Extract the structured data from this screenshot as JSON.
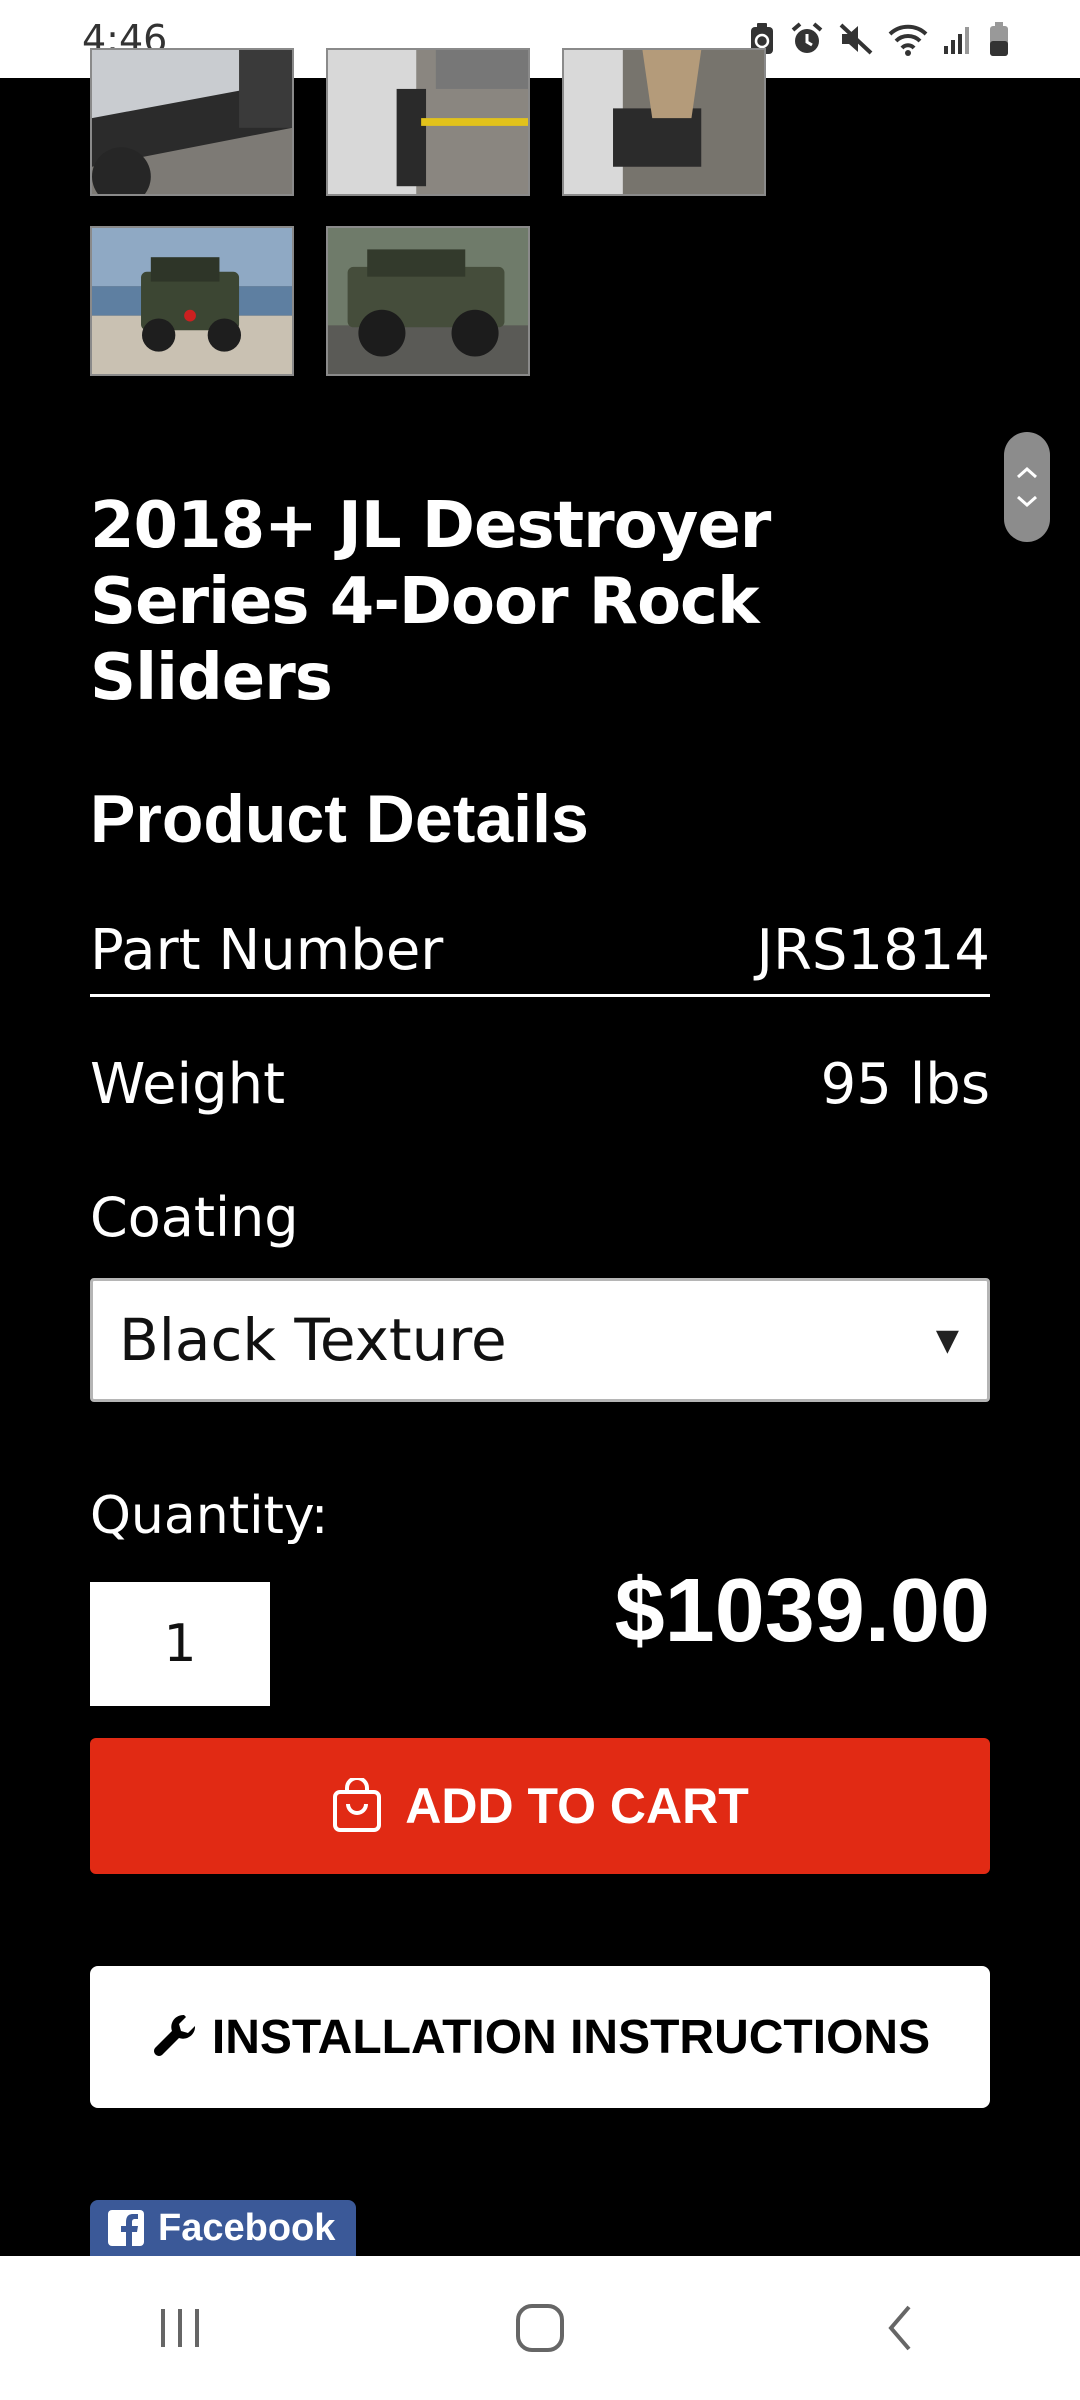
{
  "status_bar": {
    "time": "4:46",
    "icons": [
      "battery-saver-icon",
      "alarm-icon",
      "mute-icon",
      "wifi-icon",
      "signal-icon",
      "battery-icon"
    ]
  },
  "gallery": {
    "thumbnails": [
      {
        "name": "thumbnail-slider-side-view"
      },
      {
        "name": "thumbnail-slider-measure"
      },
      {
        "name": "thumbnail-slider-step"
      },
      {
        "name": "thumbnail-jeep-beach"
      },
      {
        "name": "thumbnail-jeep-side"
      }
    ]
  },
  "product": {
    "title": "2018+ JL Destroyer Series 4-Door Rock Sliders"
  },
  "details": {
    "heading": "Product Details",
    "part_number_label": "Part Number",
    "part_number_value": "JRS1814",
    "weight_label": "Weight",
    "weight_value": "95 lbs",
    "coating_label": "Coating",
    "coating_selected": "Black Texture"
  },
  "purchase": {
    "quantity_label": "Quantity:",
    "quantity_value": "1",
    "price": "$1039.00",
    "add_to_cart_label": "ADD TO CART",
    "install_label": "INSTALLATION INSTRUCTIONS",
    "accent_color": "#e12a14"
  },
  "social": {
    "facebook_label": "Facebook",
    "facebook_color": "#3b5998"
  }
}
